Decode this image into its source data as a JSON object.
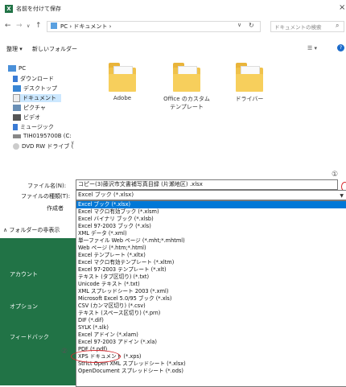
{
  "window": {
    "title": "名前を付けて保存",
    "app_icon": "excel-icon",
    "close_glyph": "×"
  },
  "address": {
    "path": "PC › ドキュメント ›",
    "search_placeholder": "ドキュメントの検索"
  },
  "toolbar": {
    "organize": "整理 ▾",
    "new_folder": "新しいフォルダー"
  },
  "nav": {
    "items": [
      {
        "label": "PC",
        "icon": "pc-icon"
      },
      {
        "label": "ダウンロード",
        "icon": "download-icon"
      },
      {
        "label": "デスクトップ",
        "icon": "desktop-icon"
      },
      {
        "label": "ドキュメント",
        "icon": "documents-icon"
      },
      {
        "label": "ピクチャ",
        "icon": "pictures-icon"
      },
      {
        "label": "ビデオ",
        "icon": "video-icon"
      },
      {
        "label": "ミュージック",
        "icon": "music-icon"
      },
      {
        "label": "TIH0195700B (C:",
        "icon": "drive-icon"
      },
      {
        "label": "DVD RW ドライブ (",
        "icon": "dvd-icon"
      }
    ]
  },
  "folders": [
    {
      "label": "Adobe"
    },
    {
      "label": "Office のカスタム テンプレート"
    },
    {
      "label": "ドライバー"
    }
  ],
  "form": {
    "filename_label": "ファイル名(N):",
    "filename_value": "コピー(3)藤沢市文書補写真目録 (片瀬地区) .xlsx",
    "filetype_label": "ファイルの種類(T):",
    "filetype_value": "Excel ブック (*.xlsx)",
    "author_label": "作成者"
  },
  "hide_folders": "∧ フォルダーの非表示",
  "backstage": {
    "account": "アカウント",
    "options": "オプション",
    "feedback": "フィードバック"
  },
  "markers": {
    "one": "①",
    "two": "②"
  },
  "filetype_options": [
    "Excel ブック (*.xlsx)",
    "Excel マクロ有効ブック (*.xlsm)",
    "Excel バイナリ ブック (*.xlsb)",
    "Excel 97-2003 ブック (*.xls)",
    "XML データ (*.xml)",
    "単一ファイル Web ページ (*.mht;*.mhtml)",
    "Web ページ (*.htm;*.html)",
    "Excel テンプレート (*.xltx)",
    "Excel マクロ有効テンプレート (*.xltm)",
    "Excel 97-2003 テンプレート (*.xlt)",
    "テキスト (タブ区切り) (*.txt)",
    "Unicode テキスト (*.txt)",
    "XML スプレッドシート 2003 (*.xml)",
    "Microsoft Excel 5.0/95 ブック (*.xls)",
    "CSV (カンマ区切り) (*.csv)",
    "テキスト (スペース区切り) (*.prn)",
    "DIF (*.dif)",
    "SYLK (*.slk)",
    "Excel アドイン (*.xlam)",
    "Excel 97-2003 アドイン (*.xla)",
    "PDF (*.pdf)",
    "XPS ドキュメント (*.xps)",
    "Strict Open XML スプレッドシート (*.xlsx)",
    "OpenDocument スプレッドシート (*.ods)"
  ],
  "colors": {
    "excel_green": "#217346",
    "highlight": "#0078d7",
    "annotation_red": "#d6272c"
  }
}
